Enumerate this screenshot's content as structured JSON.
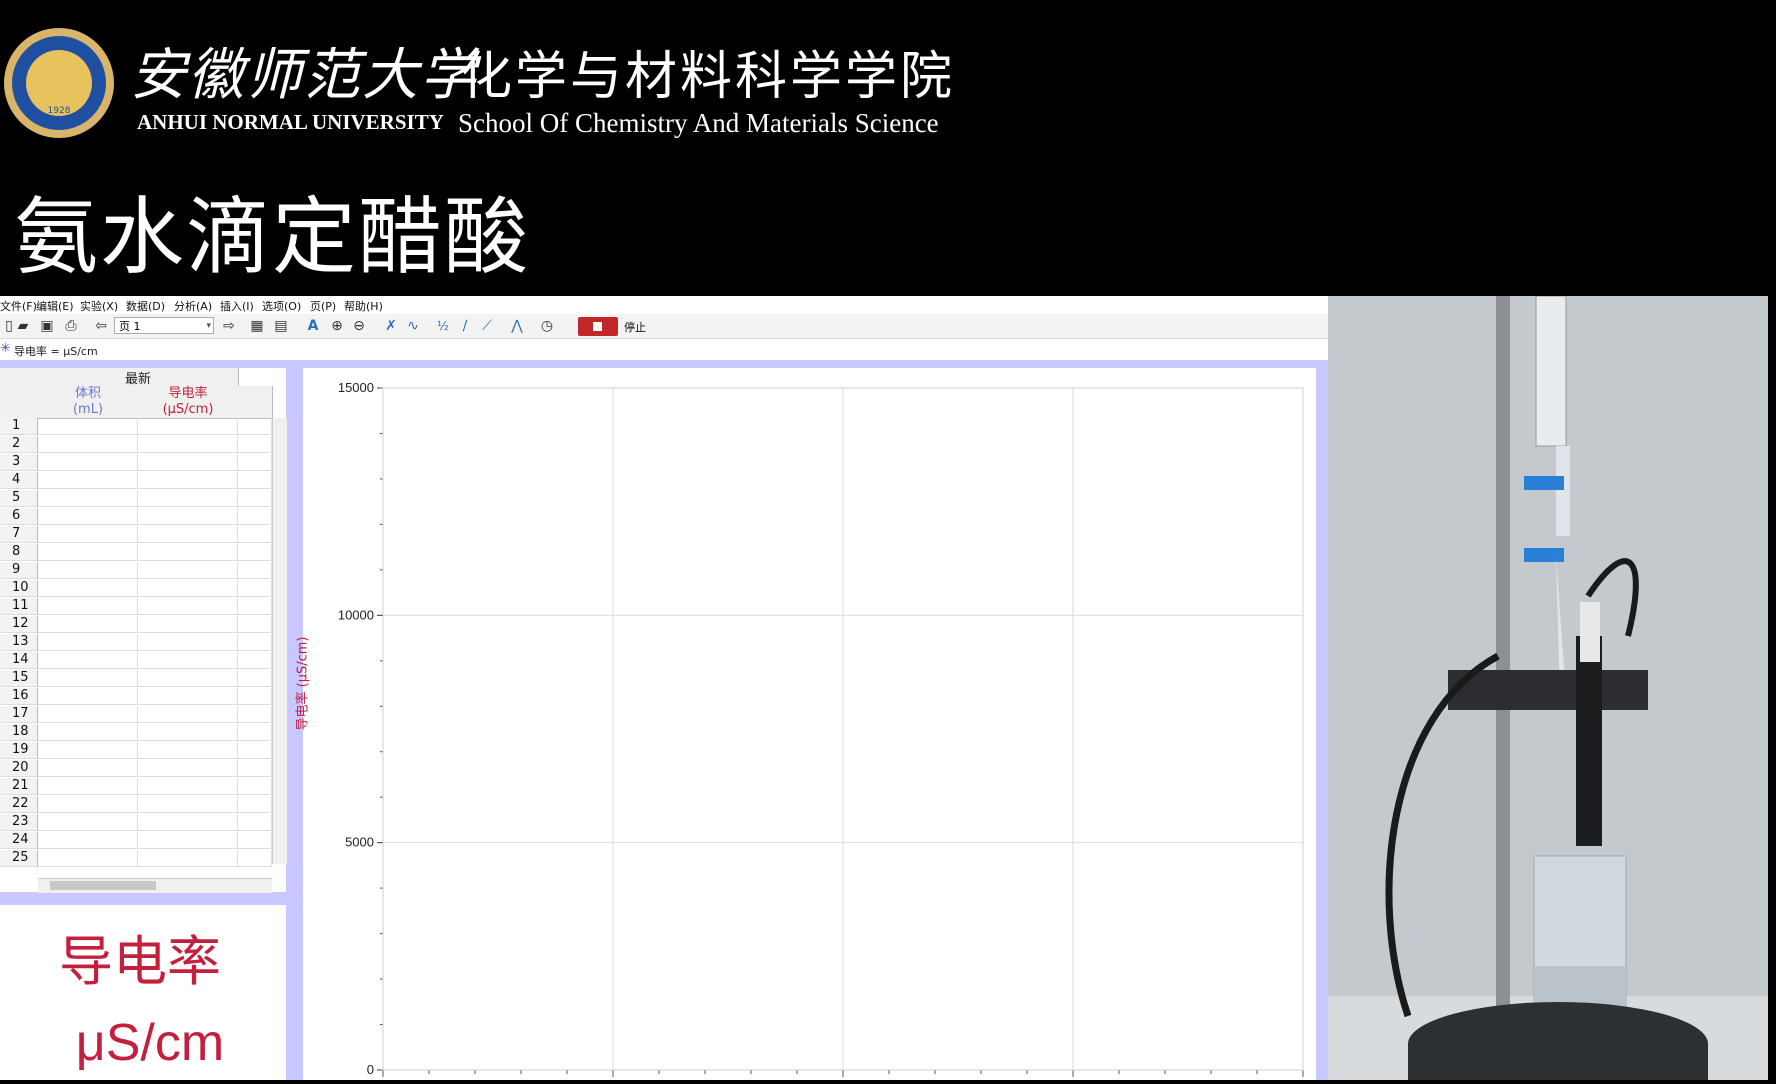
{
  "header": {
    "university_cn": "安徽师范大学",
    "university_en": "ANHUI NORMAL UNIVERSITY",
    "school_cn": "化学与材料科学学院",
    "school_en": "School Of  Chemistry And Materials Science",
    "logo_year": "1928",
    "title": "氨水滴定醋酸"
  },
  "menu": [
    "文件(F)",
    "编辑(E)",
    "实验(X)",
    "数据(D)",
    "分析(A)",
    "插入(I)",
    "选项(O)",
    "页(P)",
    "帮助(H)"
  ],
  "toolbar": {
    "page_select": "页 1",
    "stop_label": "停止"
  },
  "sensor": {
    "reading": "导电率 =  μS/cm"
  },
  "table": {
    "group_header": "最新",
    "columns": [
      {
        "name": "体积",
        "unit": "(mL)",
        "color": "#6a78d6"
      },
      {
        "name": "导电率",
        "unit": "(μS/cm)",
        "color": "#c4203e"
      }
    ],
    "row_numbers": [
      "1",
      "2",
      "3",
      "4",
      "5",
      "6",
      "7",
      "8",
      "9",
      "10",
      "11",
      "12",
      "13",
      "14",
      "15",
      "16",
      "17",
      "18",
      "19",
      "20",
      "21",
      "22",
      "23",
      "24",
      "25"
    ]
  },
  "meter": {
    "label": "导电率",
    "unit": "μS/cm"
  },
  "chart_data": {
    "type": "line",
    "title": "",
    "ylabel": "导电率 (μS/cm)",
    "xlabel": "",
    "ylim": [
      0,
      15000
    ],
    "yticks": [
      "0",
      "5000",
      "10000",
      "15000"
    ],
    "grid": true,
    "series": []
  },
  "colors": {
    "panel_bg": "#c9c7ff",
    "accent_red": "#c4203e",
    "accent_blue": "#6a78d6",
    "stop_button": "#c0282a"
  }
}
